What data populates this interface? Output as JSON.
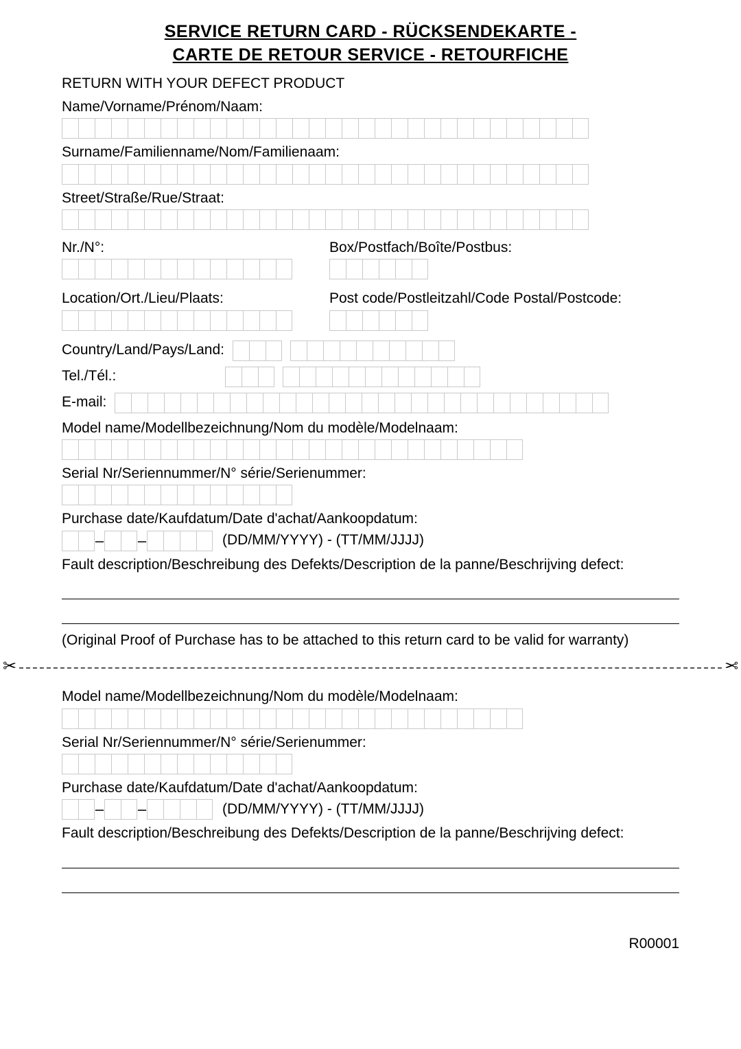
{
  "title_line1": "SERVICE RETURN CARD - RÜCKSENDEKARTE -",
  "title_line2": "CARTE DE RETOUR SERVICE - RETOURFICHE",
  "return_with": "RETURN WITH YOUR DEFECT PRODUCT",
  "labels": {
    "name": "Name/Vorname/Prénom/Naam:",
    "surname": "Surname/Familienname/Nom/Familienaam:",
    "street": "Street/Straße/Rue/Straat:",
    "nr": "Nr./N°:",
    "box": "Box/Postfach/Boîte/Postbus:",
    "location": "Location/Ort./Lieu/Plaats:",
    "postcode": "Post code/Postleitzahl/Code Postal/Postcode:",
    "country": "Country/Land/Pays/Land:",
    "tel": "Tel./Tél.:",
    "email": "E-mail:",
    "model": "Model name/Modellbezeichnung/Nom du modèle/Modelnaam:",
    "serial": "Serial Nr/Seriennummer/N° série/Serienummer:",
    "purchase": "Purchase date/Kaufdatum/Date d'achat/Aankoopdatum:",
    "date_format": "(DD/MM/YYYY) - (TT/MM/JJJJ)",
    "fault": "Fault description/Beschreibung des Defekts/Description de la panne/Beschrijving defect:",
    "proof": "(Original Proof of Purchase has to be attached to this return card to be valid for warranty)"
  },
  "box_counts": {
    "name": 32,
    "surname": 32,
    "street": 32,
    "nr": 14,
    "box": 6,
    "location": 14,
    "postcode": 6,
    "country_a": 3,
    "country_b": 10,
    "tel_a": 3,
    "tel_b": 12,
    "email": 30,
    "model": 28,
    "serial": 14,
    "date_dd": 2,
    "date_mm": 2,
    "date_yyyy": 4
  },
  "footer": "R00001"
}
